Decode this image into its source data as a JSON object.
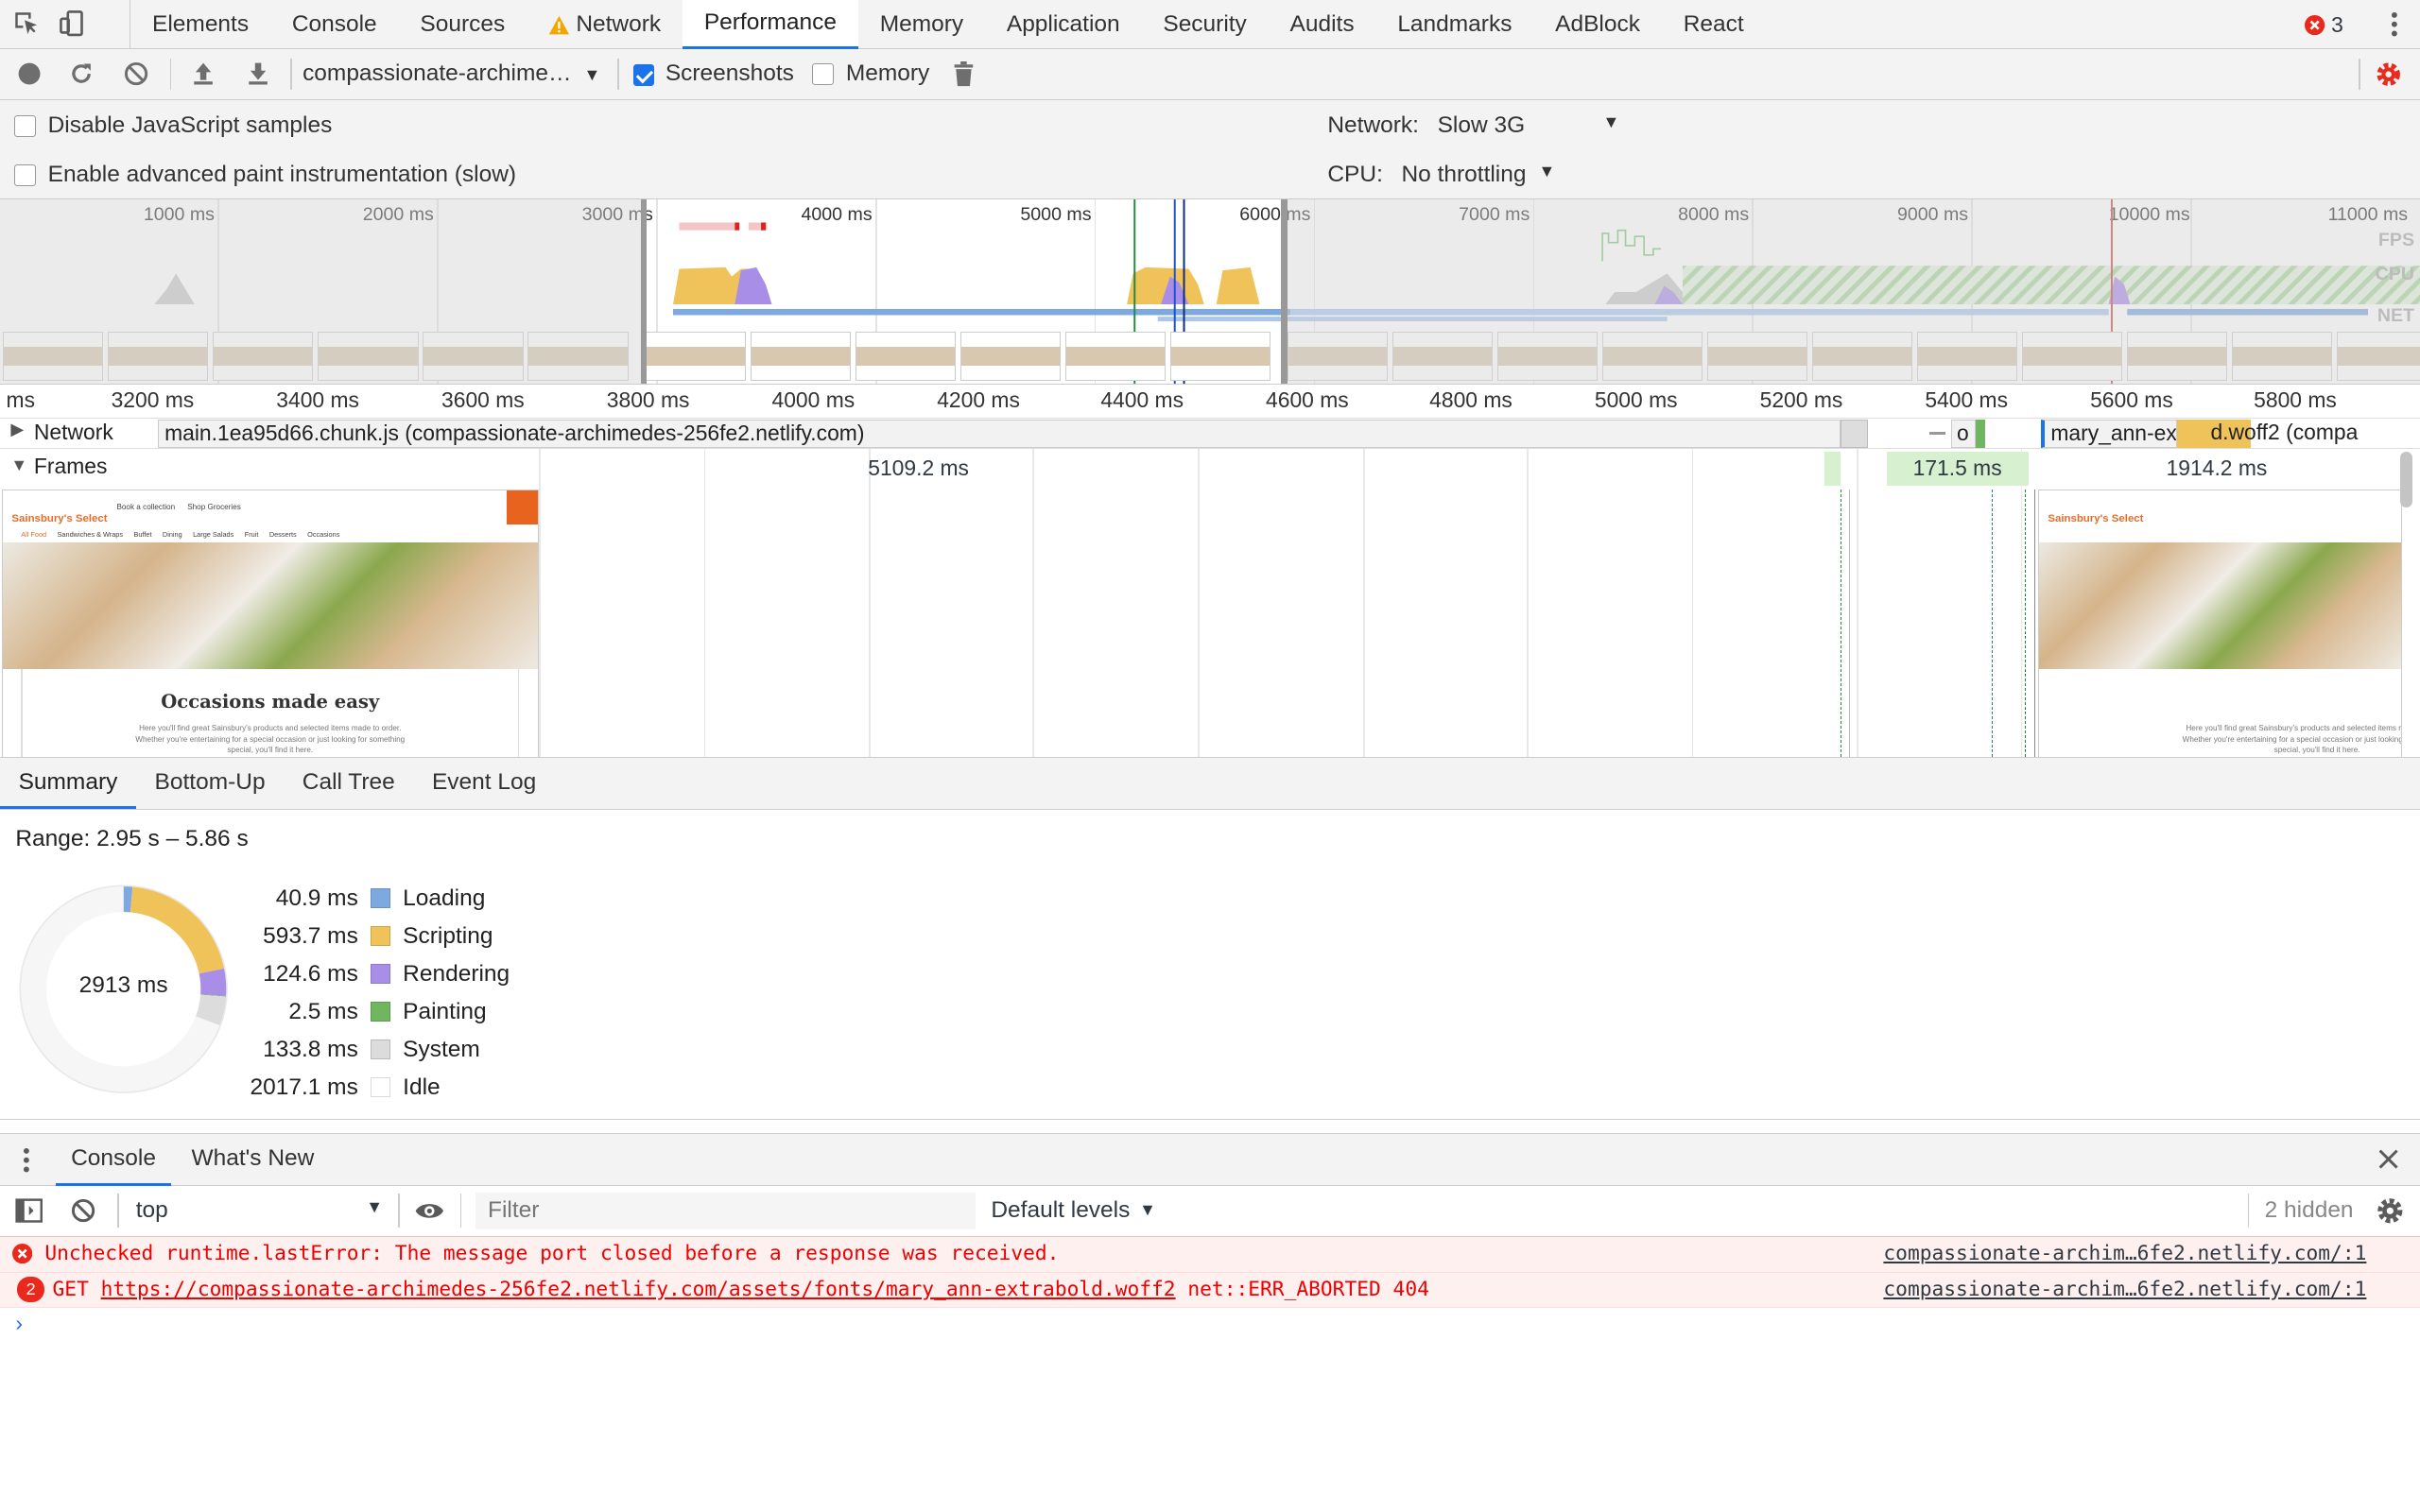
{
  "tabs": [
    "Elements",
    "Console",
    "Sources",
    "Network",
    "Performance",
    "Memory",
    "Application",
    "Security",
    "Audits",
    "Landmarks",
    "AdBlock",
    "React"
  ],
  "active_tab": "Performance",
  "error_count": "3",
  "toolbar": {
    "profile_select": "compassionate-archime…",
    "screenshots_label": "Screenshots",
    "memory_label": "Memory"
  },
  "settings": {
    "disable_js": "Disable JavaScript samples",
    "advanced_paint": "Enable advanced paint instrumentation (slow)",
    "network_label": "Network:",
    "network_value": "Slow 3G",
    "cpu_label": "CPU:",
    "cpu_value": "No throttling"
  },
  "overview": {
    "ticks": [
      "1000 ms",
      "2000 ms",
      "3000 ms",
      "4000 ms",
      "5000 ms",
      "6000 ms",
      "7000 ms",
      "8000 ms",
      "9000 ms",
      "10000 ms",
      "11000 ms"
    ],
    "labels": {
      "fps": "FPS",
      "cpu": "CPU",
      "net": "NET"
    },
    "colors": {
      "scripting": "#f0c35a",
      "rendering": "#a98ee8",
      "loading": "#7ea8e0",
      "painting": "#70b560"
    }
  },
  "ruler": [
    "ms",
    "3200 ms",
    "3400 ms",
    "3600 ms",
    "3800 ms",
    "4000 ms",
    "4200 ms",
    "4400 ms",
    "4600 ms",
    "4800 ms",
    "5000 ms",
    "5200 ms",
    "5400 ms",
    "5600 ms",
    "5800 ms"
  ],
  "tracks": {
    "network": {
      "label": "Network",
      "bar1": "main.1ea95d66.chunk.js (compassionate-archimedes-256fe2.netlify.com)",
      "bar2_left": "mary_ann-ex",
      "bar2_right": "d.woff2 (compa",
      "small": "o"
    },
    "frames": {
      "label": "Frames",
      "f1": "5109.2 ms",
      "f2": "171.5 ms",
      "f3": "1914.2 ms"
    }
  },
  "screenshot": {
    "brand": "Sainsbury's Select",
    "nav1": [
      "Book a collection",
      "Shop Groceries"
    ],
    "nav2": [
      "All Food",
      "Sandwiches & Wraps",
      "Buffet",
      "Dining",
      "Large Salads",
      "Fruit",
      "Desserts",
      "Occasions"
    ],
    "title": "Occasions made easy",
    "paragraph": "Here you'll find great Sainsbury's products and selected items made to order. Whether you're entertaining for a special occasion or just looking for something special, you'll find it here."
  },
  "summary": {
    "tabs": [
      "Summary",
      "Bottom-Up",
      "Call Tree",
      "Event Log"
    ],
    "range": "Range: 2.95 s – 5.86 s",
    "total": "2913 ms",
    "items": [
      {
        "value": "40.9 ms",
        "name": "Loading",
        "color": "#7ea8e0",
        "ms": 40.9
      },
      {
        "value": "593.7 ms",
        "name": "Scripting",
        "color": "#f0c35a",
        "ms": 593.7
      },
      {
        "value": "124.6 ms",
        "name": "Rendering",
        "color": "#a98ee8",
        "ms": 124.6
      },
      {
        "value": "2.5 ms",
        "name": "Painting",
        "color": "#70b560",
        "ms": 2.5
      },
      {
        "value": "133.8 ms",
        "name": "System",
        "color": "#dcdcdc",
        "ms": 133.8
      },
      {
        "value": "2017.1 ms",
        "name": "Idle",
        "color": "#ffffff",
        "ms": 2017.1
      }
    ]
  },
  "drawer": {
    "tabs": [
      "Console",
      "What's New"
    ],
    "context": "top",
    "filter_placeholder": "Filter",
    "levels": "Default levels",
    "hidden": "2 hidden",
    "messages": [
      {
        "badge": "",
        "text": "Unchecked runtime.lastError: The message port closed before a response was received.",
        "source": "compassionate-archim…6fe2.netlify.com/:1"
      },
      {
        "badge": "2",
        "method": "GET",
        "url": "https://compassionate-archimedes-256fe2.netlify.com/assets/fonts/mary_ann-extrabold.woff2",
        "status": "net::ERR_ABORTED 404",
        "source": "compassionate-archim…6fe2.netlify.com/:1"
      }
    ]
  }
}
